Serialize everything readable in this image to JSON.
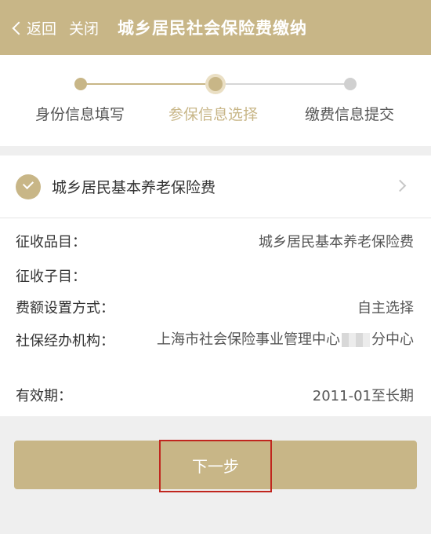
{
  "header": {
    "back_label": "返回",
    "close_label": "关闭",
    "title": "城乡居民社会保险费缴纳"
  },
  "steps": [
    {
      "label": "身份信息填写",
      "state": "done"
    },
    {
      "label": "参保信息选择",
      "state": "active"
    },
    {
      "label": "缴费信息提交",
      "state": "todo"
    }
  ],
  "insurance": {
    "name": "城乡居民基本养老保险费",
    "checked": true,
    "details": [
      {
        "label": "征收品目：",
        "value": "城乡居民基本养老保险费"
      },
      {
        "label": "征收子目：",
        "value": ""
      },
      {
        "label": "费额设置方式：",
        "value": "自主选择"
      },
      {
        "label": "社保经办机构：",
        "value_prefix": "上海市社会保险事业管理中心",
        "value_suffix": "分中心"
      },
      {
        "label": "有效期：",
        "value": "2011-01至长期"
      }
    ]
  },
  "next_button": {
    "label": "下一步"
  },
  "colors": {
    "accent": "#c8b687",
    "highlight": "#c0261e",
    "background": "#efefef"
  }
}
